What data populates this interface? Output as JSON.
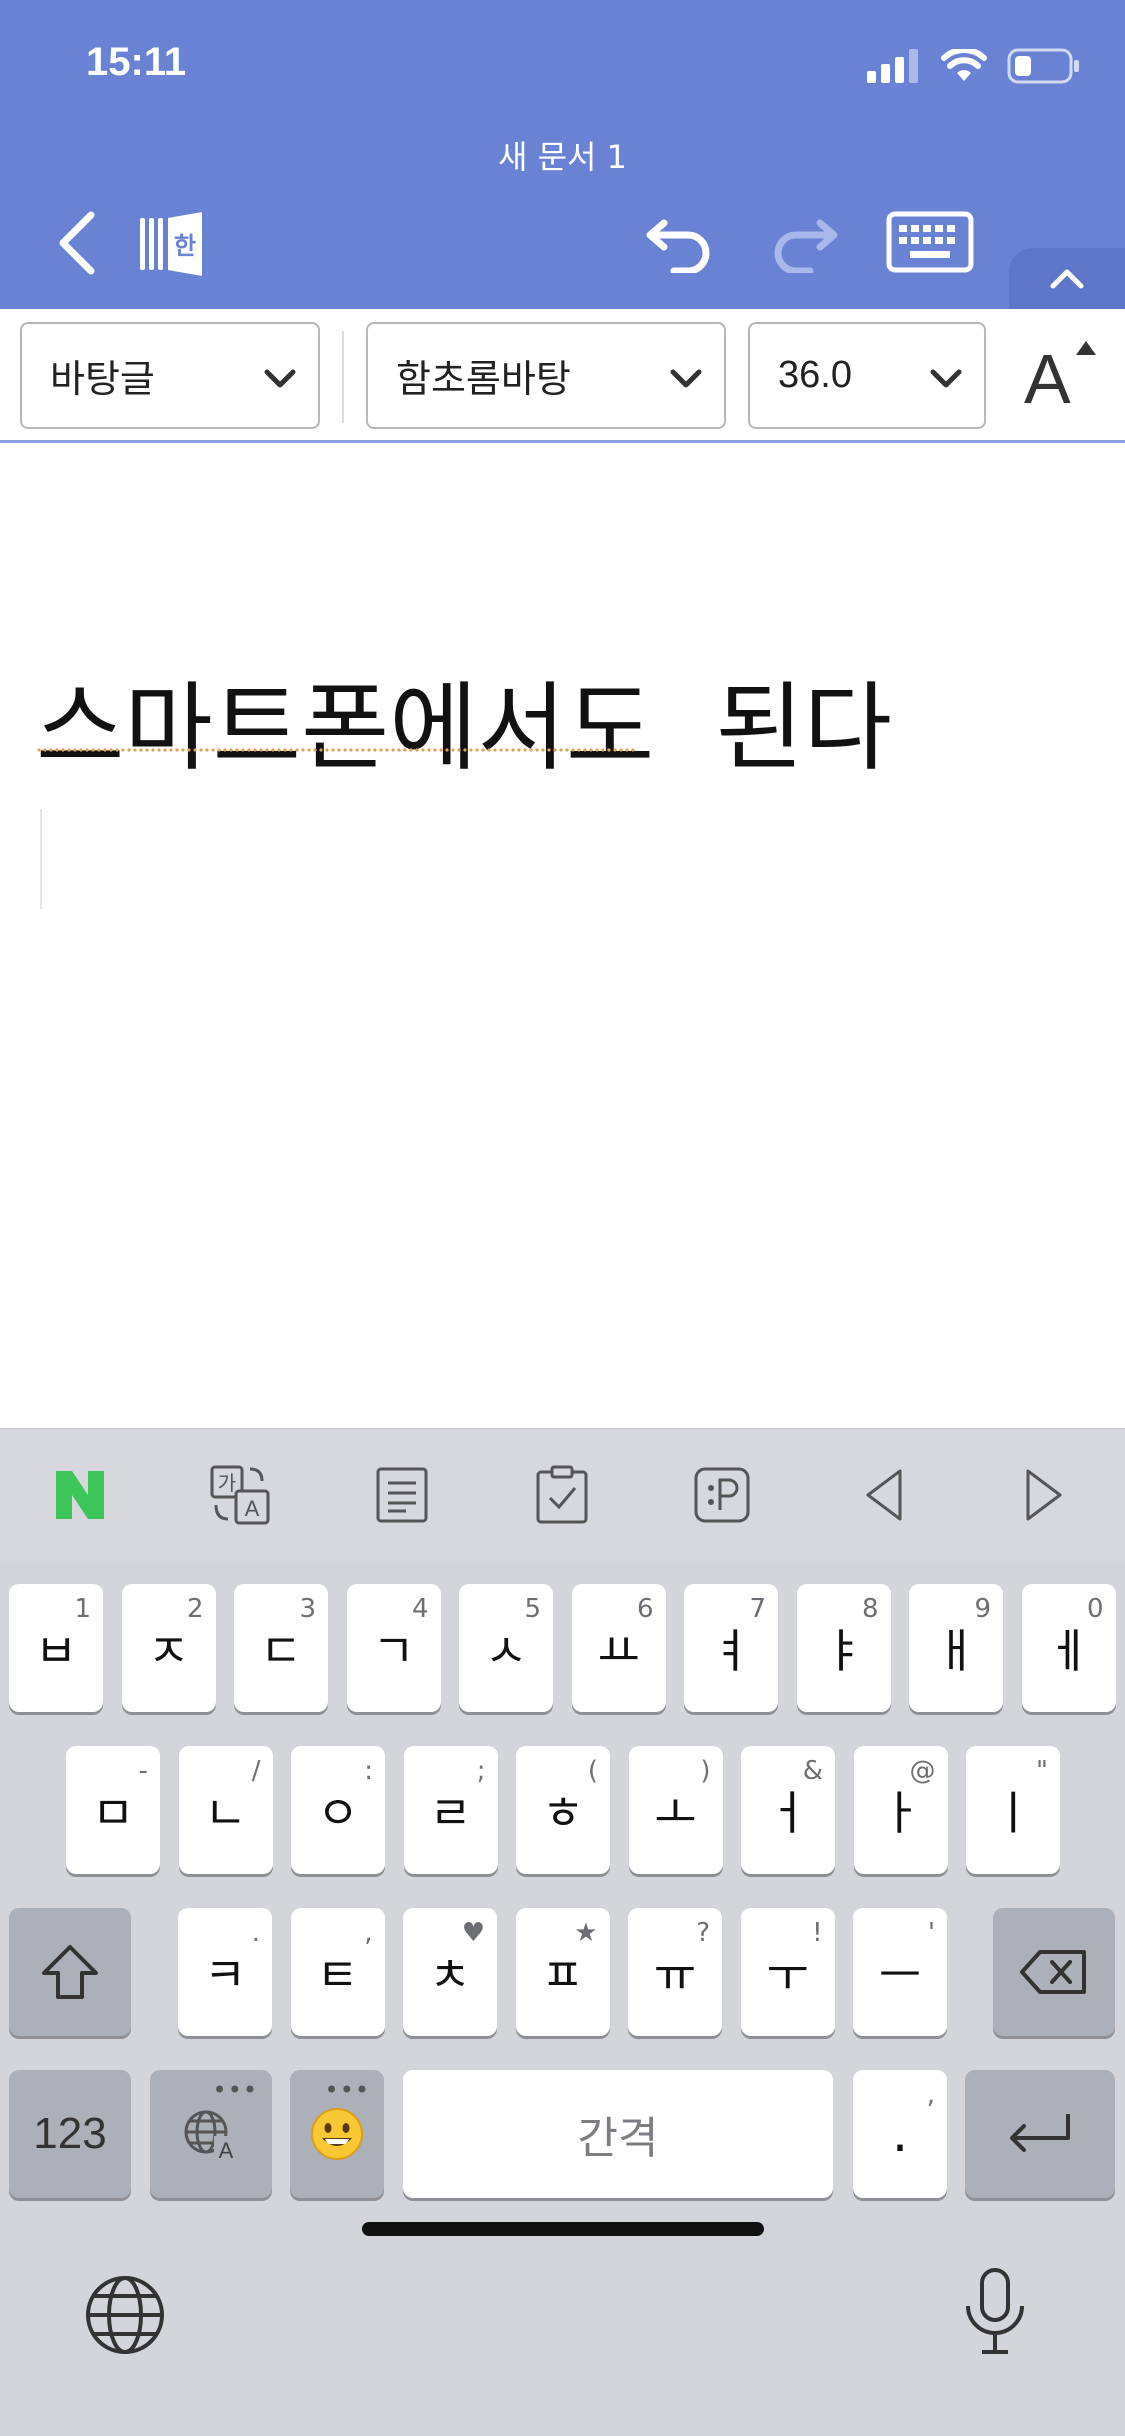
{
  "status_bar": {
    "time": "15:11"
  },
  "header": {
    "doc_title": "새 문서 1",
    "icons": [
      "back-icon",
      "hangul-app-icon",
      "undo-icon",
      "redo-icon",
      "keyboard-icon",
      "chevron-up-icon"
    ],
    "background_color": "#6a82d4"
  },
  "format_bar": {
    "style_value": "바탕글",
    "font_value": "함초롬바탕",
    "size_value": "36.0",
    "font_grow_label": "A"
  },
  "document": {
    "line1_word1": "스마트폰에서도",
    "line1_word2": "된다"
  },
  "keyboard": {
    "suggestion_icons": [
      "naver-n-icon",
      "translate-icon",
      "notes-icon",
      "clipboard-icon",
      "p-dictionary-icon",
      "cursor-left-icon",
      "cursor-right-icon"
    ],
    "row1": [
      {
        "label": "ㅂ",
        "hint": "1"
      },
      {
        "label": "ㅈ",
        "hint": "2"
      },
      {
        "label": "ㄷ",
        "hint": "3"
      },
      {
        "label": "ㄱ",
        "hint": "4"
      },
      {
        "label": "ㅅ",
        "hint": "5"
      },
      {
        "label": "ㅛ",
        "hint": "6"
      },
      {
        "label": "ㅕ",
        "hint": "7"
      },
      {
        "label": "ㅑ",
        "hint": "8"
      },
      {
        "label": "ㅐ",
        "hint": "9"
      },
      {
        "label": "ㅔ",
        "hint": "0"
      }
    ],
    "row2": [
      {
        "label": "ㅁ",
        "hint": "-"
      },
      {
        "label": "ㄴ",
        "hint": "/"
      },
      {
        "label": "ㅇ",
        "hint": ":"
      },
      {
        "label": "ㄹ",
        "hint": ";"
      },
      {
        "label": "ㅎ",
        "hint": "("
      },
      {
        "label": "ㅗ",
        "hint": ")"
      },
      {
        "label": "ㅓ",
        "hint": "&"
      },
      {
        "label": "ㅏ",
        "hint": "@"
      },
      {
        "label": "ㅣ",
        "hint": "\""
      }
    ],
    "row3": [
      {
        "label": "ㅋ",
        "hint": "."
      },
      {
        "label": "ㅌ",
        "hint": ","
      },
      {
        "label": "ㅊ",
        "hint": "♥"
      },
      {
        "label": "ㅍ",
        "hint": "★"
      },
      {
        "label": "ㅠ",
        "hint": "?"
      },
      {
        "label": "ㅜ",
        "hint": "!"
      },
      {
        "label": "ㅡ",
        "hint": "'"
      }
    ],
    "numbers_label": "123",
    "space_label": "간격",
    "period_label": ".",
    "period_hint": ",",
    "more_dots": "•••"
  }
}
